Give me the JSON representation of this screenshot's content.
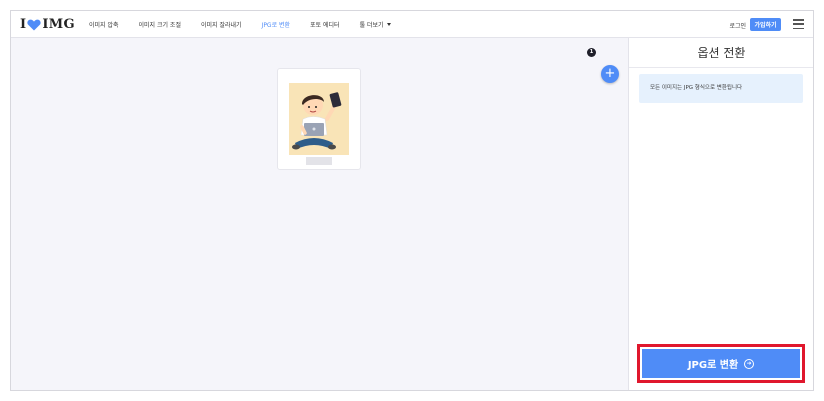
{
  "logo": {
    "left": "I",
    "right": "IMG"
  },
  "nav": {
    "items": [
      {
        "label": "이미지 압축",
        "active": false
      },
      {
        "label": "이미지 크기 조절",
        "active": false
      },
      {
        "label": "이미지 잘라내기",
        "active": false
      },
      {
        "label": "JPG로 변환",
        "active": true
      },
      {
        "label": "포토 에디터",
        "active": false
      }
    ],
    "more": "툴 더보기"
  },
  "header": {
    "login": "로그인",
    "signup": "가입하기"
  },
  "workspace": {
    "file_count": "1",
    "add_label": "+"
  },
  "sidebar": {
    "title": "옵션 전환",
    "info": "모든 이미지는 JPG 형식으로 변환됩니다",
    "convert_label": "JPG로 변환",
    "convert_arrow": "➜"
  },
  "colors": {
    "accent": "#4f8cf7",
    "highlight": "#e0172d",
    "info_bg": "#e6f1fd"
  },
  "icons": [
    "heart-icon",
    "hamburger-icon",
    "plus-icon",
    "arrow-right-circle-icon",
    "caret-down-icon"
  ]
}
